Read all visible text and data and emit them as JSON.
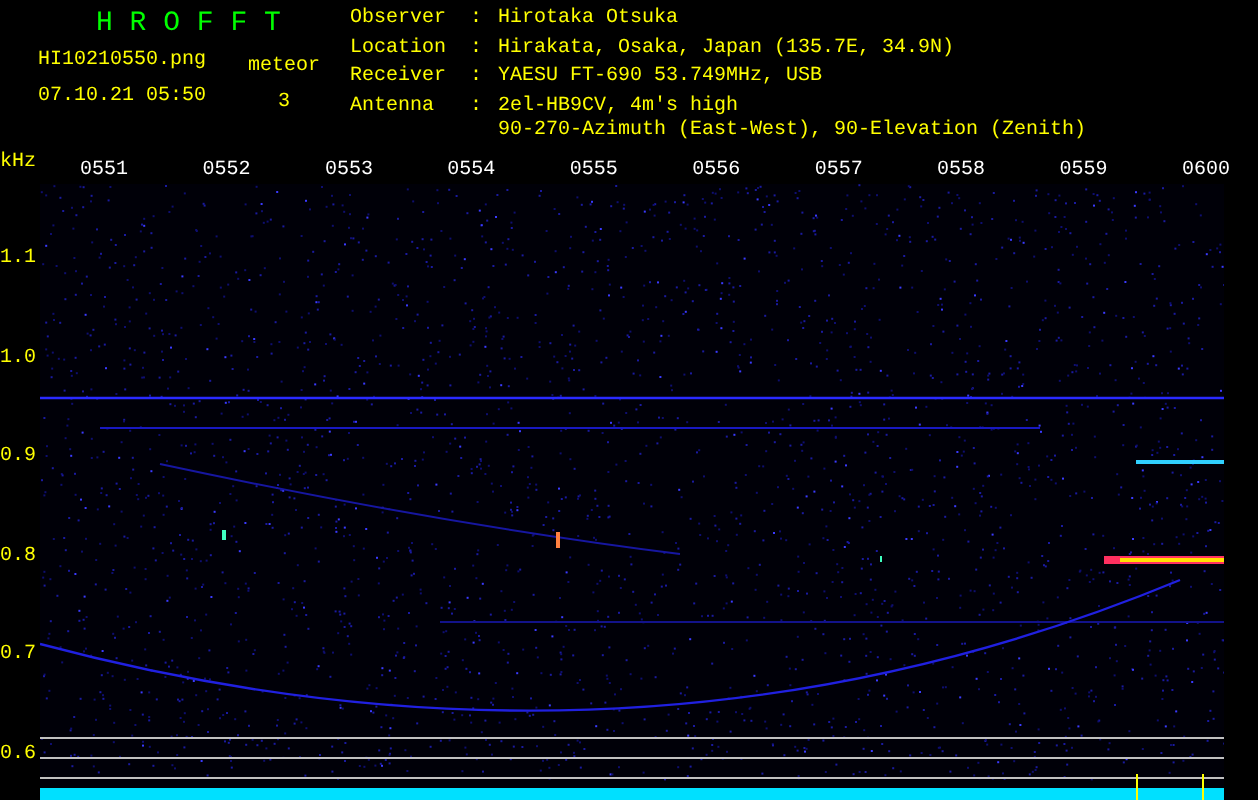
{
  "title": "H R O F F T",
  "file": "HI10210550.png",
  "timestamp": "07.10.21 05:50",
  "detection": {
    "label": "meteor",
    "count": "3"
  },
  "info": [
    {
      "label": "Observer",
      "separator": ":",
      "lines": [
        "Hirotaka Otsuka"
      ]
    },
    {
      "label": "Location",
      "separator": ":",
      "lines": [
        "Hirakata, Osaka, Japan (135.7E, 34.9N)"
      ]
    },
    {
      "label": "Receiver",
      "separator": ":",
      "lines": [
        "YAESU FT-690 53.749MHz, USB"
      ]
    },
    {
      "label": "Antenna",
      "separator": ":",
      "lines": [
        "2el-HB9CV, 4m's high",
        "90-270-Azimuth (East-West), 90-Elevation (Zenith)"
      ]
    }
  ],
  "unit": "kHz",
  "times": [
    "0551",
    "0552",
    "0553",
    "0554",
    "0555",
    "0556",
    "0557",
    "0558",
    "0559",
    "0600"
  ],
  "frequencies": [
    "1.1",
    "1.0",
    "0.9",
    "0.8",
    "0.7",
    "0.6"
  ]
}
